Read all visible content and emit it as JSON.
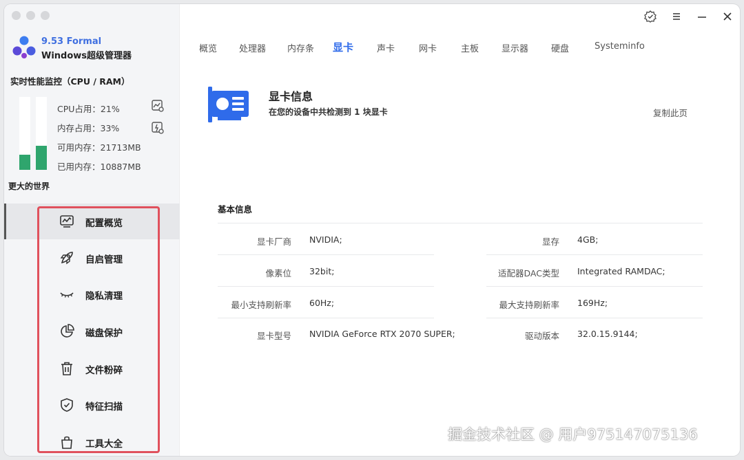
{
  "app": {
    "version": "9.53 Formal",
    "name": "Windows超级管理器"
  },
  "monitor": {
    "title": "实时性能监控（CPU / RAM）",
    "cpu_usage": "CPU占用：21%",
    "mem_usage": "内存占用：33%",
    "available_mem": "可用内存：21713MB",
    "used_mem": "已用内存：10887MB",
    "cpu_fraction": 0.21,
    "mem_fraction": 0.33,
    "slogan": "更大的世界"
  },
  "sidebar": {
    "items": [
      {
        "label": "配置概览",
        "icon": "chart-monitor-icon"
      },
      {
        "label": "自启管理",
        "icon": "rocket-icon"
      },
      {
        "label": "隐私清理",
        "icon": "closed-eye-icon"
      },
      {
        "label": "磁盘保护",
        "icon": "pie-chart-icon"
      },
      {
        "label": "文件粉碎",
        "icon": "trash-icon"
      },
      {
        "label": "特征扫描",
        "icon": "shield-check-icon"
      },
      {
        "label": "工具大全",
        "icon": "bag-icon"
      }
    ]
  },
  "tabs": [
    "概览",
    "处理器",
    "内存条",
    "显卡",
    "声卡",
    "网卡",
    "主板",
    "显示器",
    "硬盘",
    "Systeminfo"
  ],
  "active_tab": "显卡",
  "header": {
    "title": "显卡信息",
    "subtitle": "在您的设备中共检测到 1 块显卡",
    "copy": "复制此页"
  },
  "basic": {
    "title": "基本信息",
    "rows": [
      {
        "k1": "显卡厂商",
        "v1": "NVIDIA;",
        "k2": "显存",
        "v2": "4GB;"
      },
      {
        "k1": "像素位",
        "v1": "32bit;",
        "k2": "适配器DAC类型",
        "v2": "Integrated RAMDAC;"
      },
      {
        "k1": "最小支持刷新率",
        "v1": "60Hz;",
        "k2": "最大支持刷新率",
        "v2": "169Hz;"
      },
      {
        "k1": "显卡型号",
        "v1": "NVIDIA GeForce RTX 2070 SUPER;",
        "k2": "驱动版本",
        "v2": "32.0.15.9144;"
      }
    ]
  },
  "watermark": "掘金技术社区 @ 用户975147075136",
  "colors": {
    "accent": "#2f6bea",
    "bar": "#2fa56d",
    "highlight": "#e0515d",
    "brand": "#3f6fe0"
  }
}
